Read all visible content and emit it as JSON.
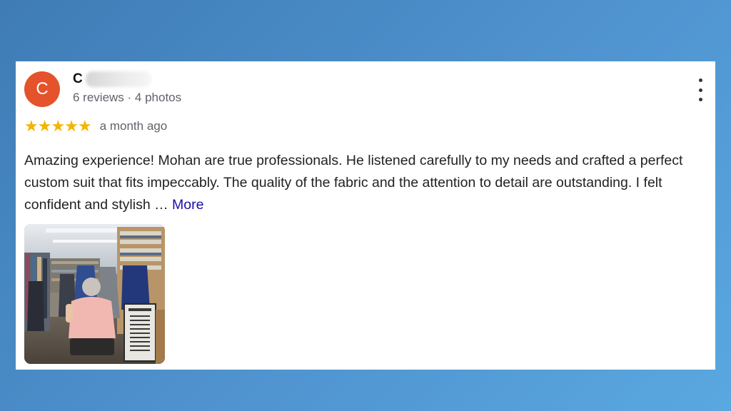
{
  "review": {
    "avatar_letter": "C",
    "author_initial": "C",
    "meta": "6 reviews · 4 photos",
    "rating": 5,
    "stars": [
      "★",
      "★",
      "★",
      "★",
      "★"
    ],
    "time": "a month ago",
    "text": "Amazing experience! Mohan are true professionals. He listened carefully to my needs and crafted a perfect custom suit that fits impeccably. The quality of the fabric and the attention to detail are outstanding. I felt confident and stylish …",
    "more_label": "More",
    "photo": {
      "sign_title": "Pheean's",
      "sign_lines": [
        "SUITS",
        "SHIRTS",
        "TUXEDO",
        "LADY",
        "TROUSERS",
        "COAT",
        "SHIRTS",
        "BLAZER",
        "JACKETS",
        "TIES"
      ]
    }
  },
  "colors": {
    "avatar": "#e4532b",
    "star": "#f4b400",
    "link": "#1a0dab",
    "background": "#4a8cc8"
  },
  "icons": {
    "menu": "more-vert-icon",
    "star": "star-icon"
  }
}
